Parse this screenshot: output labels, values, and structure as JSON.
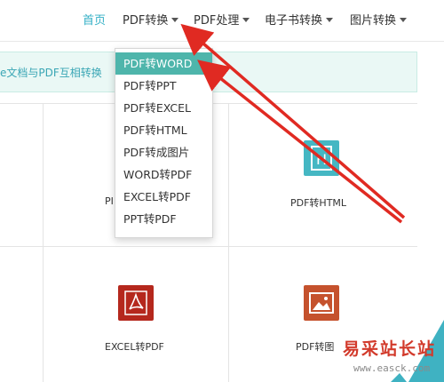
{
  "nav": {
    "items": [
      {
        "label": "首页",
        "active": true,
        "has_caret": false
      },
      {
        "label": "PDF转换",
        "has_caret": true
      },
      {
        "label": "PDF处理",
        "has_caret": true
      },
      {
        "label": "电子书转换",
        "has_caret": true
      },
      {
        "label": "图片转换",
        "has_caret": true
      }
    ]
  },
  "banner": {
    "text": "e文档与PDF互相转换"
  },
  "dropdown": {
    "items": [
      {
        "label": "PDF转WORD",
        "selected": true
      },
      {
        "label": "PDF转PPT"
      },
      {
        "label": "PDF转EXCEL"
      },
      {
        "label": "PDF转HTML"
      },
      {
        "label": "PDF转成图片"
      },
      {
        "label": "WORD转PDF"
      },
      {
        "label": "EXCEL转PDF"
      },
      {
        "label": "PPT转PDF"
      }
    ]
  },
  "tiles": {
    "partial_left_label": "PI",
    "html_label": "PDF转HTML",
    "html_icon_letter": "H",
    "excel_label": "EXCEL转PDF",
    "image_label": "PDF转图"
  },
  "watermark": {
    "cn": "易采站长站",
    "url": "www.easck.com"
  },
  "colors": {
    "accent": "#34b0c6",
    "selected": "#4eb5ab",
    "arrow": "#e02a22"
  }
}
